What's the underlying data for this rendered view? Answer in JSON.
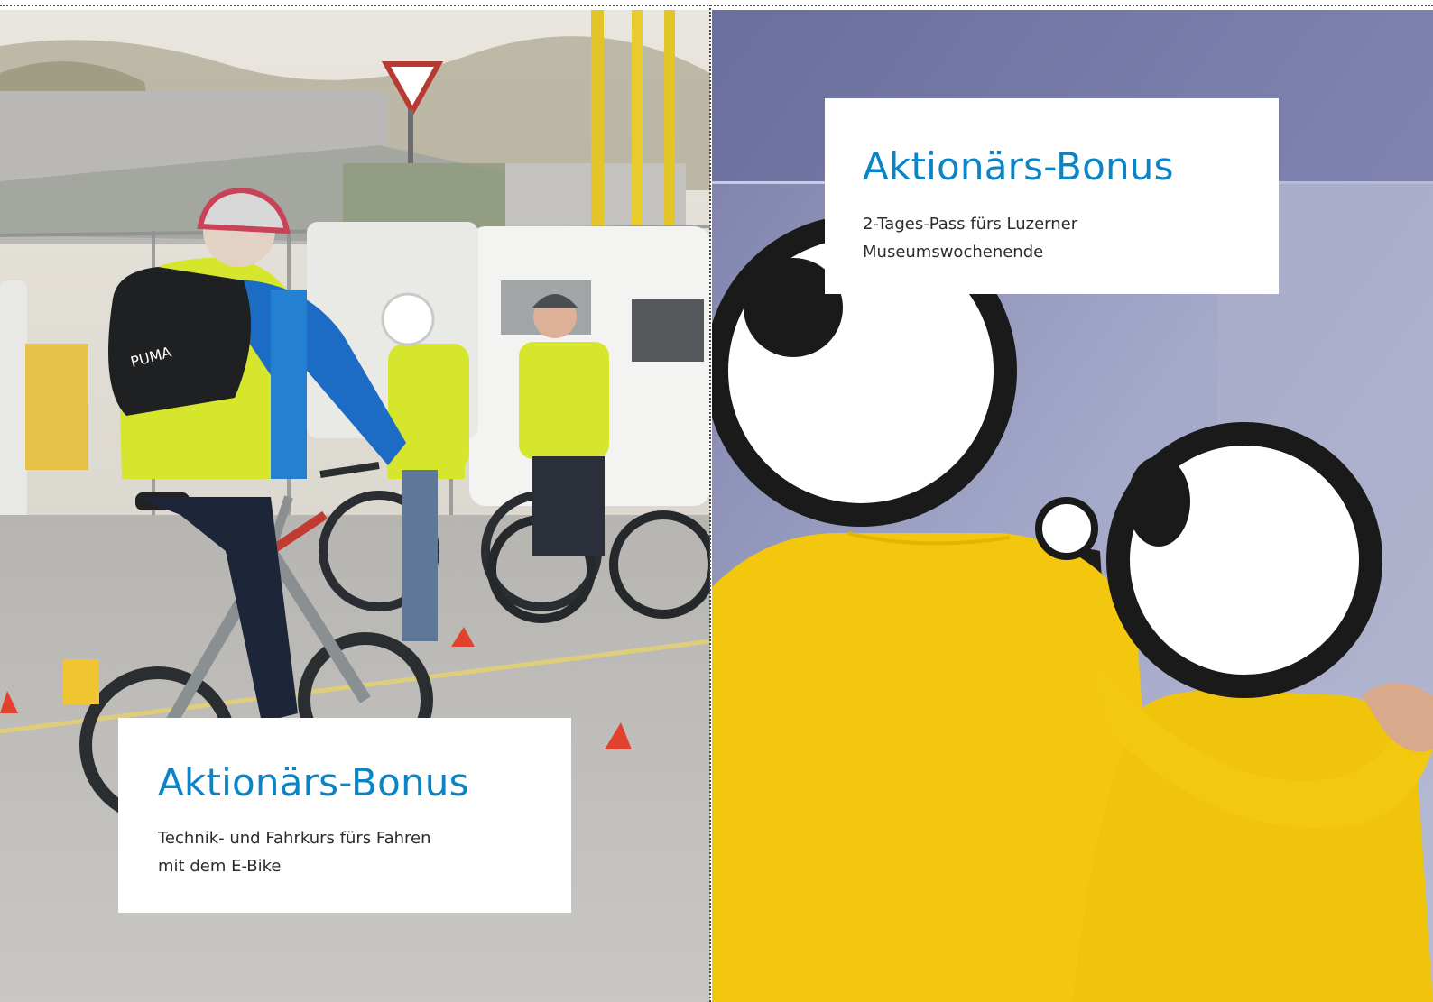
{
  "left_card": {
    "title": "Aktionärs-Bonus",
    "line1": "Technik- und Fahrkurs fürs Fahren",
    "line2": "mit dem E-Bike"
  },
  "right_card": {
    "title": "Aktionärs-Bonus",
    "line1": "2-Tages-Pass fürs Luzerner",
    "line2": "Museumswochenende"
  },
  "colors": {
    "accent_blue": "#0a84c6",
    "body_text": "#2b2b2b",
    "vest_yellow": "#d6e62c",
    "sweater_yellow": "#f2c70d"
  }
}
